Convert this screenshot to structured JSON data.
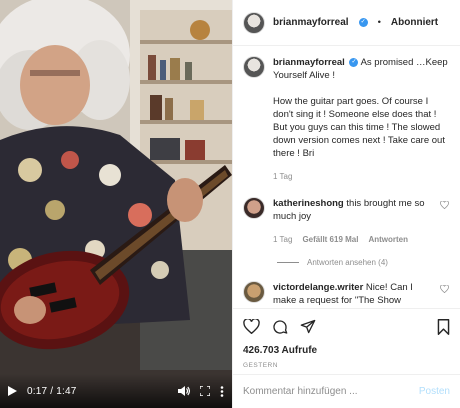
{
  "video": {
    "time": "0:17 / 1:47",
    "progress": 0.159,
    "controls": [
      "play-icon",
      "volume-icon",
      "fullscreen-icon",
      "more-icon"
    ]
  },
  "header": {
    "username": "brianmayforreal",
    "separator": "•",
    "follow_status": "Abonniert"
  },
  "caption": {
    "username": "brianmayforreal",
    "line1": "As promised …Keep Yourself Alive !",
    "line2": "How the guitar part goes. Of course I don't sing it ! Someone else does that ! But you guys can this time ! The slowed down version comes next ! Take care out there ! Bri",
    "age": "1 Tag"
  },
  "comments": [
    {
      "username": "katherineshong",
      "text": "this brought me so much joy",
      "age": "1 Tag",
      "likes": "Gefällt 619 Mal",
      "reply": "Antworten",
      "view_replies": "Antworten ansehen (4)"
    },
    {
      "username": "victordelange.writer",
      "text": "Nice! Can I make a request for \"The Show"
    }
  ],
  "actions": {
    "icons": [
      "heart-icon",
      "comment-icon",
      "share-icon",
      "bookmark-icon"
    ],
    "views": "426.703 Aufrufe",
    "date": "GESTERN"
  },
  "add_comment": {
    "placeholder": "Kommentar hinzufügen ...",
    "post_label": "Posten"
  },
  "colors": {
    "verified": "#3897f0",
    "post_button_disabled": "#b2dffc",
    "muted_text": "#8e8e8e"
  }
}
